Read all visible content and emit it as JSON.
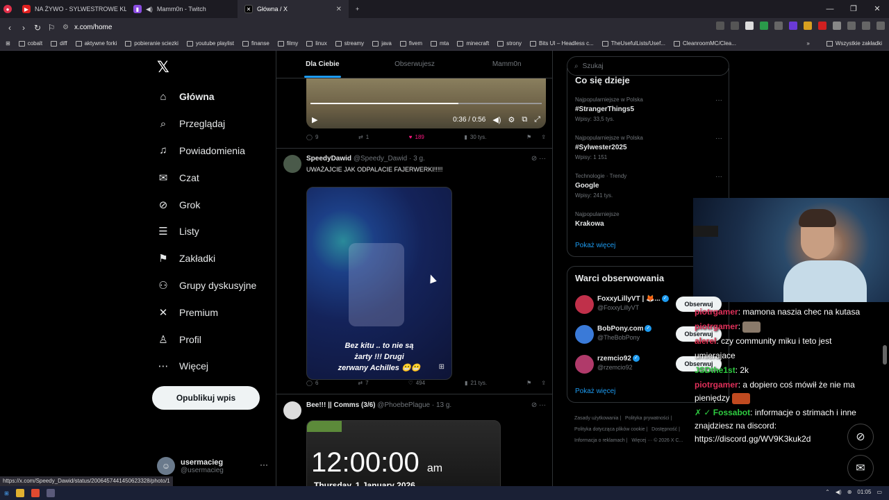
{
  "browser": {
    "tabs": [
      {
        "label": "NA ŻYWO - SYLWESTROWE KLUB",
        "active": false
      },
      {
        "label": "Mamm0n - Twitch",
        "active": false
      },
      {
        "label": "Główna / X",
        "active": true
      }
    ],
    "new_tab": "+",
    "address": "x.com/home",
    "bookmarks": [
      "cobalt",
      "diff",
      "aktywne forki",
      "pobieranie sciezki",
      "youtube playlist",
      "finanse",
      "filmy",
      "linux",
      "streamy",
      "java",
      "fivem",
      "mta",
      "minecraft",
      "strony",
      "Bits UI – Headless c...",
      "TheUsefulLists/Usef...",
      "CleanroomMC/Clea..."
    ],
    "bookmarks_more": "»",
    "all_bookmarks": "Wszystkie zakładki",
    "status_url": "https://x.com/Speedy_Dawid/status/2006457441450623328/photo/1"
  },
  "nav": {
    "items": [
      {
        "label": "Główna",
        "icon": "home-icon",
        "glyph": "⌂"
      },
      {
        "label": "Przeglądaj",
        "icon": "search-icon",
        "glyph": "⌕"
      },
      {
        "label": "Powiadomienia",
        "icon": "bell-icon",
        "glyph": "♫"
      },
      {
        "label": "Czat",
        "icon": "mail-icon",
        "glyph": "✉"
      },
      {
        "label": "Grok",
        "icon": "grok-icon",
        "glyph": "⊘"
      },
      {
        "label": "Listy",
        "icon": "list-icon",
        "glyph": "☰"
      },
      {
        "label": "Zakładki",
        "icon": "bookmark-icon",
        "glyph": "⚑"
      },
      {
        "label": "Grupy dyskusyjne",
        "icon": "community-icon",
        "glyph": "⚇"
      },
      {
        "label": "Premium",
        "icon": "x-logo-icon",
        "glyph": "✕"
      },
      {
        "label": "Profil",
        "icon": "profile-icon",
        "glyph": "♙"
      },
      {
        "label": "Więcej",
        "icon": "more-icon",
        "glyph": "⋯"
      }
    ],
    "post_button": "Opublikuj wpis",
    "account": {
      "name": "usermacieg",
      "handle": "@usermacieg"
    }
  },
  "timeline": {
    "tabs": [
      "Dla Ciebie",
      "Obserwujesz",
      "Mamm0n"
    ],
    "video1": {
      "time": "0:36 / 0:56",
      "progress": 0.64
    },
    "post1_actions": {
      "replies": "9",
      "reposts": "1",
      "likes": "189",
      "views": "30 tys."
    },
    "post2": {
      "name": "SpeedyDawid",
      "handle": "@Speedy_Dawid",
      "time": "· 3 g.",
      "text": "UWAŻAJCIE JAK ODPALACIE FAJERWERKI!!!!!",
      "caption": [
        "Bez kitu .. to nie są",
        "żarty !!! Drugi",
        "zerwany Achilles 😬😬"
      ],
      "actions": {
        "replies": "6",
        "reposts": "7",
        "likes": "494",
        "views": "21 tys."
      }
    },
    "post3": {
      "name": "Bee!!! || Comms (3/6)",
      "handle": "@PhoebePlague",
      "time": "· 13 g.",
      "clock": "12:00:00",
      "ampm": "am",
      "date": "Thursday, 1 January 2026"
    }
  },
  "sidebar": {
    "search_placeholder": "Szukaj",
    "trends_title": "Co się dzieje",
    "trends": [
      {
        "meta": "Najpopularniejsze w Polska",
        "title": "#StrangerThings5",
        "count": "Wpisy: 33,5 tys."
      },
      {
        "meta": "Najpopularniejsze w Polska",
        "title": "#Sylwester2025",
        "count": "Wpisy: 1 151"
      },
      {
        "meta": "Technologie · Trendy",
        "title": "Google",
        "count": "Wpisy: 241 tys."
      },
      {
        "meta": "Najpopularniejsze",
        "title": "Krakowa",
        "count": ""
      }
    ],
    "show_more": "Pokaż więcej",
    "who_title": "Warci obserwowania",
    "who": [
      {
        "name": "FoxxyLillyVT | 🦊...",
        "handle": "@FoxxyLillyVT",
        "color": "#c0304a"
      },
      {
        "name": "BobPony.com",
        "handle": "@TheBobPony",
        "color": "#3a7ad8"
      },
      {
        "name": "rzemcio92",
        "handle": "@rzemcio92",
        "color": "#b03a6a"
      }
    ],
    "follow_label": "Obserwuj",
    "who_more": "Pokaż więcej",
    "footer": [
      "Zasady użytkowania |",
      "Polityka prywatności |",
      "Polityka dotycząca plików cookie |",
      "Dostępność |",
      "Informacja o reklamach |",
      "Więcej ··· © 2026 X C..."
    ]
  },
  "chat": [
    {
      "user": "piotrgamer",
      "color": "#e0305a",
      "text": ": mamona naszia chec na kutasa"
    },
    {
      "user": "piotrgamer",
      "color": "#e0305a",
      "text": ":"
    },
    {
      "user": "alerel",
      "color": "#e03050",
      "text": ": czy community miku i teto jest"
    },
    {
      "user": "",
      "color": "#fff",
      "text": "umierajace"
    },
    {
      "user": "JSDthe1st",
      "color": "#2ecc40",
      "text": ": 2k"
    },
    {
      "user": "piotrgamer",
      "color": "#e0305a",
      "text": ": a dopiero coś mówił że nie ma pieniędzy"
    },
    {
      "user": "✗ ✓ Fossabot",
      "color": "#2ecc40",
      "text": ": informacje o strimach i inne znajdziesz na discord: https://discord.gg/WV9K3kuk2d"
    }
  ],
  "taskbar": {
    "time": "01:05"
  }
}
